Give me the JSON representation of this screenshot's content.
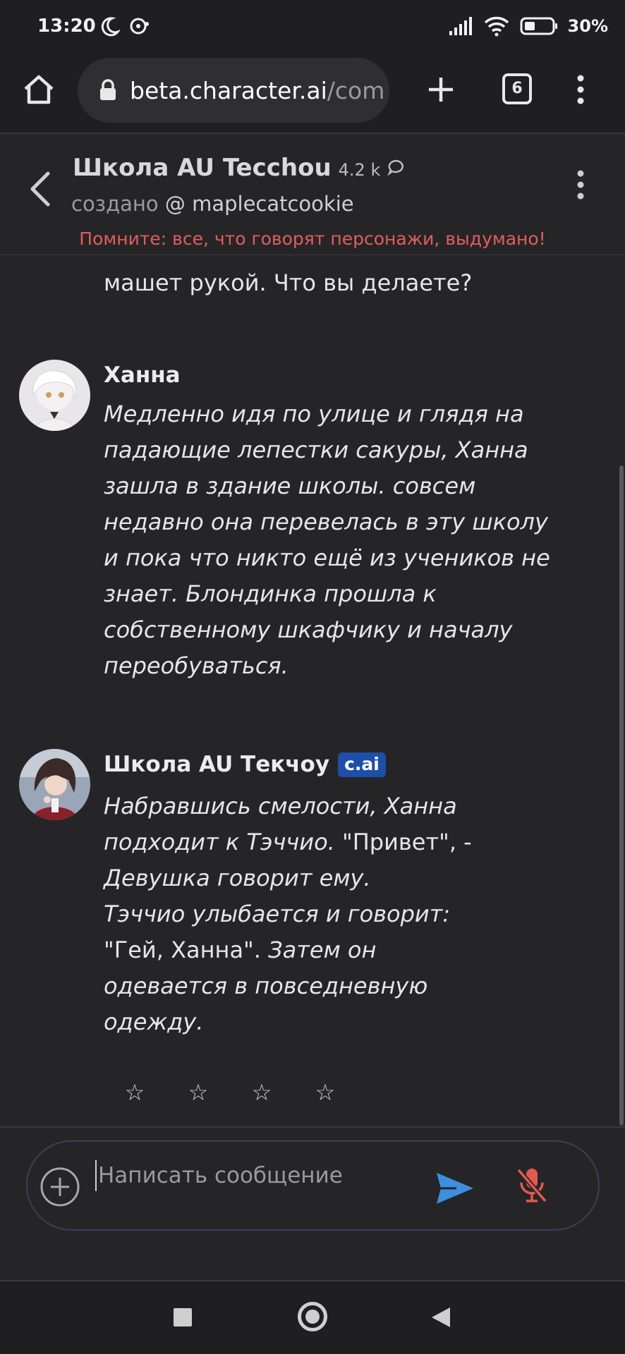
{
  "status_bar": {
    "time": "13:20",
    "battery": "30%",
    "icons": [
      "moon-icon",
      "notification-icon",
      "signal-icon",
      "wifi-icon",
      "battery-icon"
    ]
  },
  "browser": {
    "url_host": "beta.character.ai",
    "url_path": "/com",
    "tab_count": "6",
    "icons": [
      "home-icon",
      "lock-icon",
      "plus-icon",
      "tabs-icon",
      "more-vert-icon"
    ]
  },
  "chat_header": {
    "title": "Школа AU Tecchou",
    "count": "4.2 k",
    "created_label": "создано",
    "creator_handle": "@ maplecatcookie",
    "warning": "Помните: все, что говорят персонажи, выдумано!"
  },
  "messages": {
    "previous_tail": "машет рукой. Что вы делаете?",
    "items": [
      {
        "name": "Ханна",
        "lines": [
          "Медленно идя по улице и глядя на",
          "падающие лепестки сакуры, Ханна",
          "зашла в здание школы. совсем",
          "недавно она перевелась в эту школу",
          "и пока что никто ещё из учеников не",
          "знает. Блондинка прошла к",
          "собственному шкафчику и началу",
          "переобуваться."
        ]
      },
      {
        "name": "Школа AU Текчоу",
        "badge": "c.ai",
        "lines": [
          "Набравшись смелости, Ханна",
          "подходит к Тэччио.",
          " \"Привет\", -",
          "Девушка говорит ему.",
          "Тэччио улыбается и говорит:",
          "\"Гей, Ханна\".",
          " Затем он",
          "одевается в повседневную",
          "одежду."
        ]
      }
    ],
    "rating_stars": [
      "☆",
      "☆",
      "☆",
      "☆"
    ]
  },
  "composer": {
    "placeholder": "Написать сообщение",
    "value": ""
  },
  "colors": {
    "background": "#252528",
    "warning": "#e35d5b",
    "badge": "#1e4ea8",
    "send": "#3d8fdf",
    "mic_off": "#e05a4f"
  }
}
